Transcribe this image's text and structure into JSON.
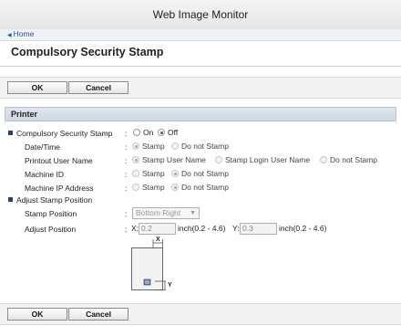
{
  "window": {
    "title": "Web Image Monitor"
  },
  "nav": {
    "home_label": "Home"
  },
  "page": {
    "title": "Compulsory Security Stamp"
  },
  "buttons": {
    "ok_label": "OK",
    "cancel_label": "Cancel"
  },
  "section": {
    "title": "Printer"
  },
  "stamp": {
    "label": "Compulsory Security Stamp",
    "colon": ":",
    "on_label": "On",
    "off_label": "Off",
    "selected": "Off"
  },
  "date_time": {
    "label": "Date/Time",
    "colon": ":",
    "opt1": "Stamp",
    "opt2": "Do not Stamp",
    "selected": "Stamp"
  },
  "printout_user": {
    "label": "Printout User Name",
    "colon": ":",
    "opt1": "Stamp User Name",
    "opt2": "Stamp Login User Name",
    "opt3": "Do not Stamp",
    "selected": "Stamp User Name"
  },
  "machine_id": {
    "label": "Machine ID",
    "colon": ":",
    "opt1": "Stamp",
    "opt2": "Do not Stamp",
    "selected": "Do not Stamp"
  },
  "machine_ip": {
    "label": "Machine IP Address",
    "colon": ":",
    "opt1": "Stamp",
    "opt2": "Do not Stamp",
    "selected": "Do not Stamp"
  },
  "adjust": {
    "label": "Adjust Stamp Position",
    "position_label": "Stamp Position",
    "position_colon": ":",
    "position_value": "Bottom Right",
    "adjust_label": "Adjust Position",
    "adjust_colon": ":",
    "x_label": "X:",
    "x_value": "0.2",
    "x_range": "inch(0.2 - 4.6)",
    "y_label": "Y:",
    "y_value": "0.3",
    "y_range": "inch(0.2 - 4.6)",
    "diagram_x": "X",
    "diagram_y": "Y"
  },
  "colors": {
    "accent": "#2b3f73",
    "link": "#2a55a0",
    "section_bg": "#dfe6ee"
  }
}
